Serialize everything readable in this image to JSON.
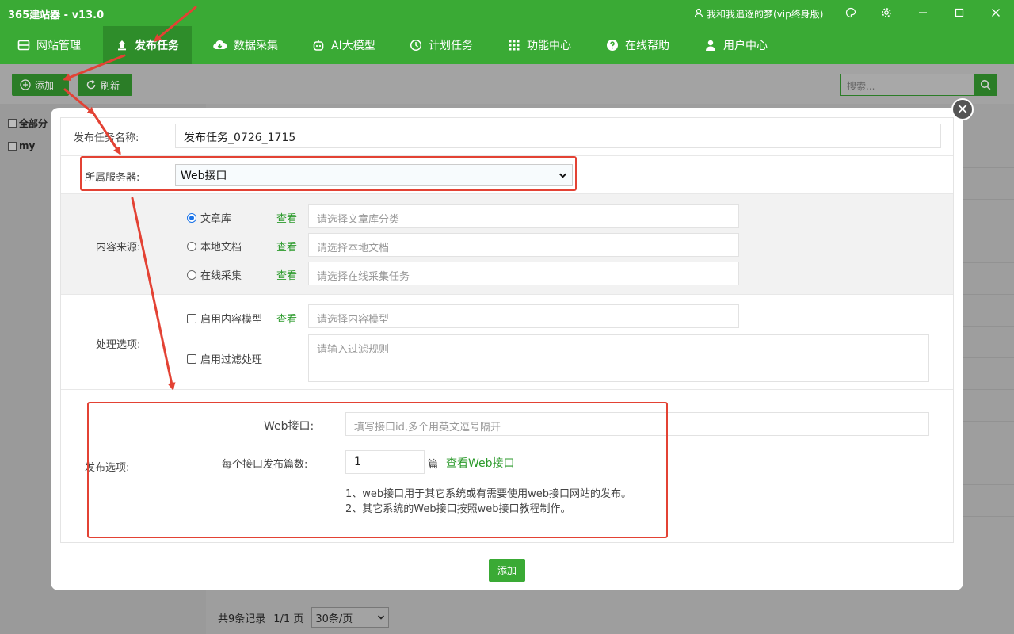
{
  "app": {
    "title": "365建站器 - v13.0",
    "user": "我和我追逐的梦(vip终身版)"
  },
  "nav": [
    {
      "label": "网站管理",
      "icon": "site-icon"
    },
    {
      "label": "发布任务",
      "icon": "upload-icon",
      "active": true
    },
    {
      "label": "数据采集",
      "icon": "cloud-download-icon"
    },
    {
      "label": "AI大模型",
      "icon": "robot-icon"
    },
    {
      "label": "计划任务",
      "icon": "clock-icon"
    },
    {
      "label": "功能中心",
      "icon": "grid-icon"
    },
    {
      "label": "在线帮助",
      "icon": "help-icon"
    },
    {
      "label": "用户中心",
      "icon": "user-icon"
    }
  ],
  "toolbar": {
    "add_label": "添加",
    "refresh_label": "刷新",
    "search_placeholder": "搜索..."
  },
  "sidebar": {
    "all_label": "全部分",
    "my_label": "my"
  },
  "pager": {
    "records": "共9条记录",
    "pages": "1/1 页",
    "per_page": "30条/页"
  },
  "form": {
    "task_name_label": "发布任务名称:",
    "task_name_value": "发布任务_0726_1715",
    "server_label": "所属服务器:",
    "server_value": "Web接口",
    "content_source_label": "内容来源:",
    "sources": [
      {
        "label": "文章库",
        "link": "查看",
        "placeholder": "请选择文章库分类",
        "checked": true
      },
      {
        "label": "本地文档",
        "link": "查看",
        "placeholder": "请选择本地文档",
        "checked": false
      },
      {
        "label": "在线采集",
        "link": "查看",
        "placeholder": "请选择在线采集任务",
        "checked": false
      }
    ],
    "processing_label": "处理选项:",
    "content_model_label": "启用内容模型",
    "content_model_link": "查看",
    "content_model_placeholder": "请选择内容模型",
    "filter_label": "启用过滤处理",
    "filter_placeholder": "请输入过滤规则",
    "publish_label": "发布选项:",
    "web_api_label": "Web接口:",
    "web_api_placeholder": "填写接口id,多个用英文逗号隔开",
    "per_api_label": "每个接口发布篇数:",
    "per_api_value": "1",
    "per_api_unit": "篇",
    "view_web_api_link": "查看Web接口",
    "note1": "1、web接口用于其它系统或有需要使用web接口网站的发布。",
    "note2": "2、其它系统的Web接口按照web接口教程制作。",
    "submit_label": "添加"
  },
  "colors": {
    "brand": "#3aaa35",
    "annotation": "#e34234",
    "link": "#2b9a2b"
  }
}
